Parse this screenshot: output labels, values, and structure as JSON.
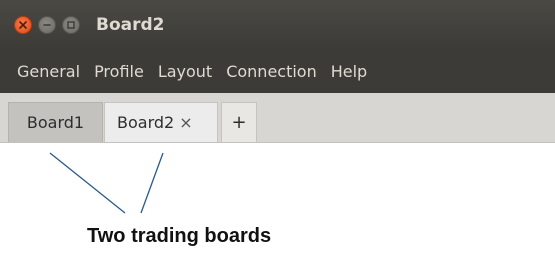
{
  "window": {
    "title": "Board2",
    "buttons": [
      "close-icon",
      "minimize-icon",
      "maximize-icon"
    ]
  },
  "menubar": {
    "items": [
      "General",
      "Profile",
      "Layout",
      "Connection",
      "Help"
    ]
  },
  "tabs": [
    {
      "label": "Board1",
      "active": false,
      "closable": false
    },
    {
      "label": "Board2",
      "active": true,
      "closable": true,
      "close_glyph": "×"
    },
    {
      "label": "+",
      "is_add": true
    }
  ],
  "annotation": {
    "caption": "Two trading boards",
    "line_color": "#2a5a8a"
  },
  "colors": {
    "titlebar": "#3c3b37",
    "menu_text": "#dfdbd2",
    "close_button": "#df4a16"
  }
}
